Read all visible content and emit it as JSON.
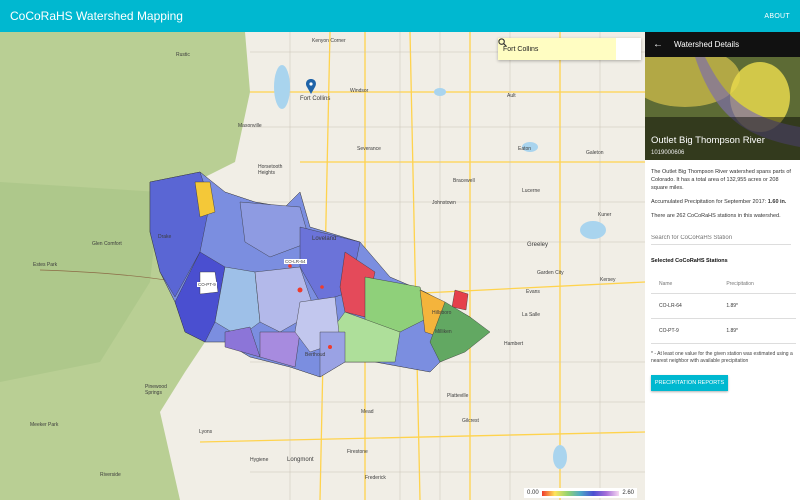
{
  "app": {
    "title": "CoCoRaHS Watershed Mapping",
    "about_label": "ABOUT"
  },
  "search": {
    "value": "Fort Collins"
  },
  "map": {
    "places": [
      "Kenyon Corner",
      "Fort Collins",
      "Windsor",
      "Ault",
      "Eaton",
      "Horsetooth Heights",
      "Loveland",
      "Johnstown",
      "Greeley",
      "Evans",
      "Kersey",
      "Milliken",
      "Berthoud",
      "Platteville",
      "Mead",
      "Gilcrest",
      "Longmont",
      "Firestone",
      "Frederick",
      "Hygiene",
      "Lyons",
      "Pinewood Springs",
      "Meeker Park",
      "Riverside",
      "Estes Park",
      "Glen Comfort",
      "Drake",
      "Galeton",
      "Lucerne",
      "Severance",
      "Bracewell",
      "Garden City",
      "La Salle",
      "Hillsboro",
      "Hambert",
      "Kuner",
      "Masonville",
      "Rustic"
    ],
    "marker_label": "CO-PT-9",
    "marker_label2": "CO-LR-64"
  },
  "legend": {
    "min": "0.00",
    "max": "2.60"
  },
  "colors": {
    "accent": "#00b8d0",
    "header_dark": "#111111"
  },
  "panel": {
    "header": "Watershed Details",
    "title": "Outlet Big Thompson River",
    "code": "1019000606",
    "description": "The Outlet Big Thompson River watershed spans parts of Colorado. It has a total area of 132,955 acres or 208 square miles.",
    "precip_label": "Accumulated Precipitation for September 2017: ",
    "precip_value": "1.60 in.",
    "stations_text": "There are 262 CoCoRaHS stations in this watershed.",
    "station_search_placeholder": "Search for CoCoRaHS Station",
    "selected_title": "Selected CoCoRaHS Stations",
    "table": {
      "headers": [
        "Name",
        "Precipitation"
      ],
      "rows": [
        [
          "CO-LR-64",
          "1.89*"
        ],
        [
          "CO-PT-9",
          "1.89*"
        ]
      ]
    },
    "footnote": "* - At least one value for the given station was estimated using a nearest neighbor with available precipitation",
    "report_button": "PRECIPITATION REPORTS"
  }
}
